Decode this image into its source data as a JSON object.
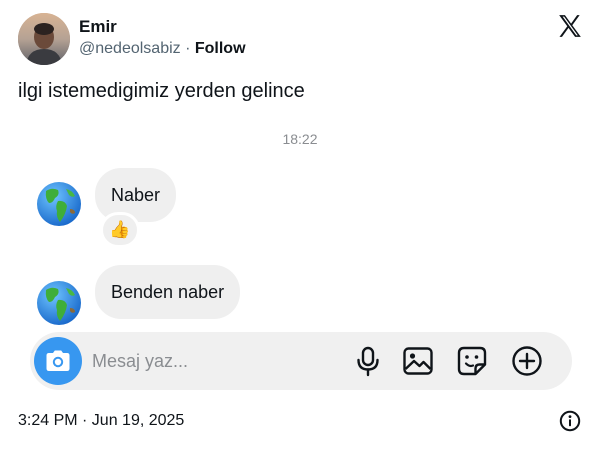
{
  "author": {
    "name": "Emir",
    "handle": "@nedeolsabiz",
    "separator": " · ",
    "follow_label": "Follow",
    "avatar_icon": "user-avatar"
  },
  "brand": {
    "logo_icon": "x-logo-icon"
  },
  "tweet": {
    "text": "ilgi istemedigimiz yerden gelince",
    "timestamp": "3:24 PM · Jun 19, 2025"
  },
  "chat": {
    "time": "18:22",
    "messages": [
      {
        "text": "Naber",
        "reaction": "👍",
        "sender_icon": "globe-earth-icon"
      },
      {
        "text": "Benden naber",
        "sender_icon": "globe-earth-icon"
      }
    ],
    "composer": {
      "placeholder": "Mesaj yaz...",
      "value": "",
      "icons": [
        "camera-icon",
        "microphone-icon",
        "image-icon",
        "sticker-icon",
        "plus-icon"
      ]
    }
  },
  "colors": {
    "accent": "#3797f0",
    "bubble": "#efefef",
    "composer_bg": "#f0f0f0",
    "muted_text": "#536471",
    "time_text": "#8a8d91"
  }
}
